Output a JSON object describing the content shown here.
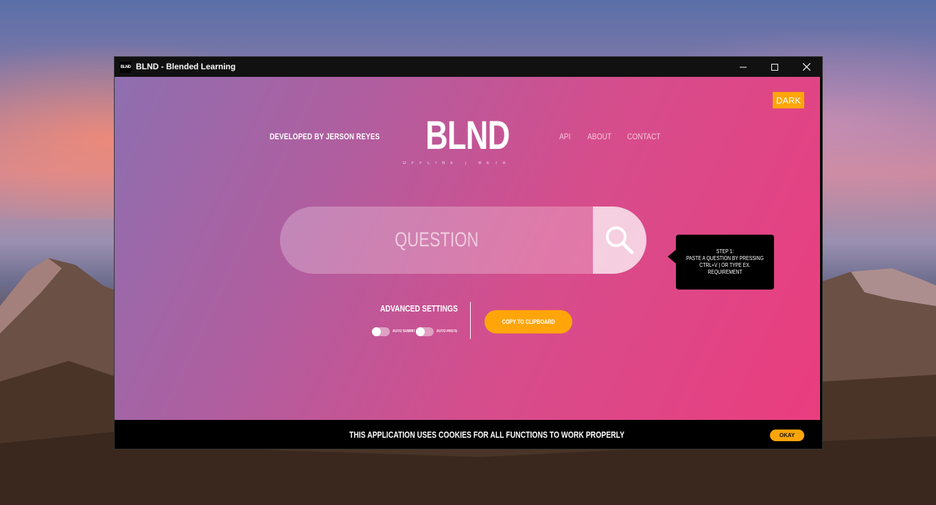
{
  "window": {
    "icon_text": "BLND",
    "title": "BLND - Blended Learning",
    "controls": {
      "minimize": "—",
      "maximize": "☐",
      "close": "✕"
    }
  },
  "header": {
    "theme_button": "DARK",
    "developer": "DEVELOPED BY JERSON REYES",
    "logo": "BLND",
    "logo_sub": "OFFLINE | BETA",
    "nav": [
      "API",
      "ABOUT",
      "CONTACT"
    ]
  },
  "search": {
    "placeholder": "QUESTION",
    "button_icon": "search-icon"
  },
  "tooltip": {
    "lines": [
      "STEP 1:",
      "PASTE A QUESTION BY PRESSING",
      "CTRL+V | OR TYPE EX.",
      "REQUIREMENT"
    ]
  },
  "settings": {
    "title": "ADVANCED SETTINGS",
    "toggles": [
      {
        "label": "AUTO SUBMIT",
        "on": false
      },
      {
        "label": "AUTO PASTE",
        "on": false
      }
    ],
    "copy_button": "COPY TO CLIPBOARD"
  },
  "cookie_bar": {
    "message": "THIS APPLICATION USES COOKIES FOR ALL FUNCTIONS TO WORK PROPERLY",
    "button": "OKAY"
  },
  "colors": {
    "accent": "#ffa50a",
    "gradient_start": "#8e6fb0",
    "gradient_end": "#ea3d7e"
  }
}
